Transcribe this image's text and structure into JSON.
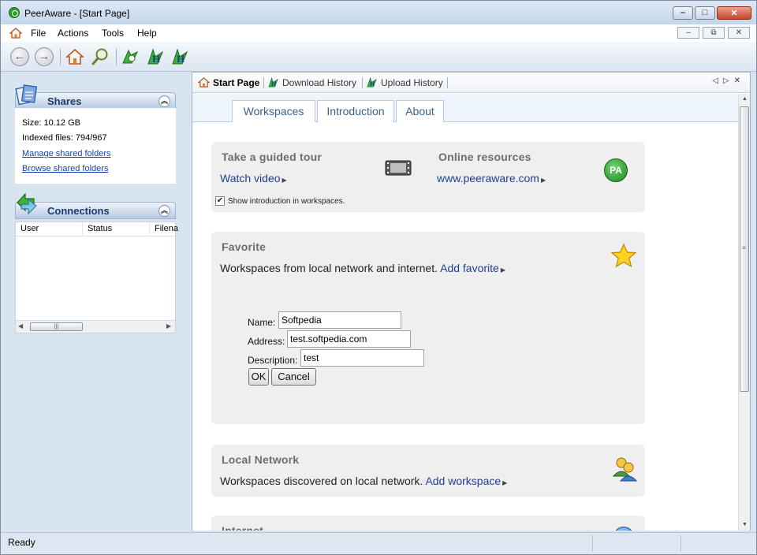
{
  "window": {
    "title": "PeerAware - [Start Page]"
  },
  "menu": [
    "File",
    "Actions",
    "Tools",
    "Help"
  ],
  "shares": {
    "title": "Shares",
    "size": "Size: 10.12 GB",
    "indexed": "Indexed files: 794/967",
    "manage": "Manage shared folders",
    "browse": "Browse shared folders"
  },
  "connections": {
    "title": "Connections",
    "columns": [
      "User",
      "Status",
      "Filena"
    ]
  },
  "tabs": [
    "Start Page",
    "Download History",
    "Upload History"
  ],
  "subtabs": [
    "Workspaces",
    "Introduction",
    "About"
  ],
  "tour": {
    "title": "Take a guided tour",
    "watch": "Watch video",
    "resources_title": "Online resources",
    "site": "www.peeraware.com",
    "checkbox_label": "Show introduction in workspaces.",
    "pa_logo": "PA"
  },
  "favorite": {
    "title": "Favorite",
    "desc": "Workspaces from local network and internet.",
    "add": "Add favorite",
    "name_label": "Name:",
    "name_value": "Softpedia",
    "address_label": "Address:",
    "address_value": "test.softpedia.com",
    "description_label": "Description:",
    "description_value": "test",
    "ok": "OK",
    "cancel": "Cancel"
  },
  "local": {
    "title": "Local Network",
    "desc": "Workspaces discovered on local network.",
    "add": "Add workspace"
  },
  "internet": {
    "title": "Internet"
  },
  "status": {
    "text": "Ready"
  },
  "colors": {
    "accent": "#1f3f8f",
    "card": "#efefef",
    "panel_title": "#173d6d"
  }
}
